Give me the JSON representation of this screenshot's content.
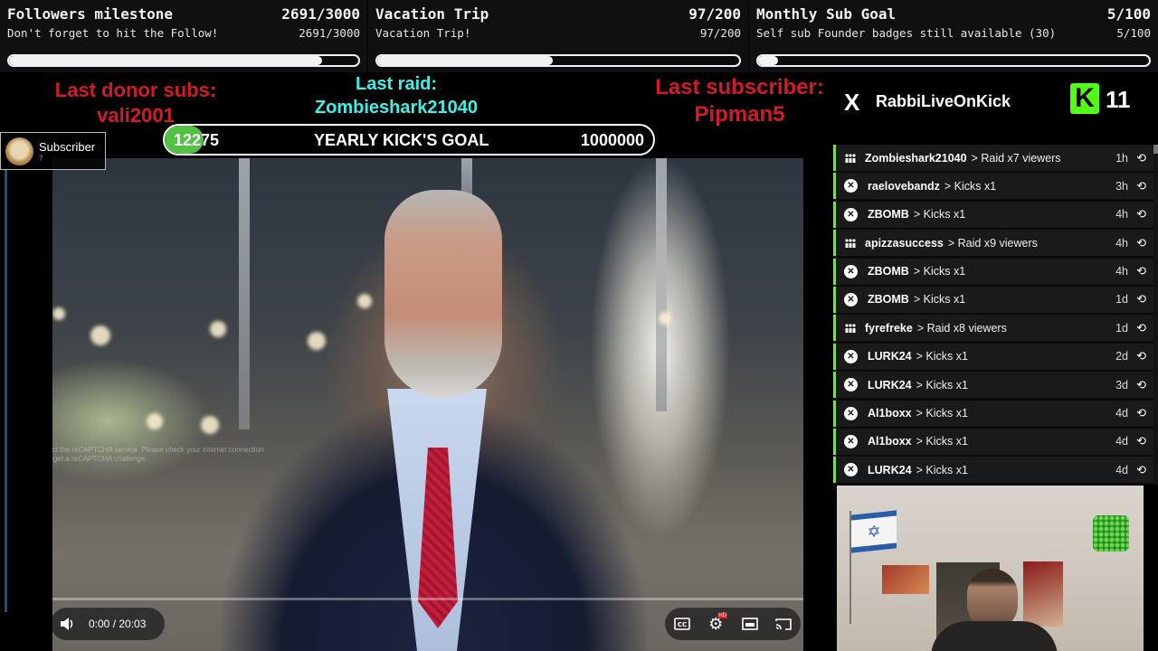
{
  "goals": [
    {
      "title": "Followers milestone",
      "count": "2691/3000",
      "subtitle": "Don't forget to hit the Follow!",
      "sub_count": "2691/3000",
      "progress": 0.897
    },
    {
      "title": "Vacation Trip",
      "count": "97/200",
      "subtitle": "Vacation Trip!",
      "sub_count": "97/200",
      "progress": 0.485
    },
    {
      "title": "Monthly Sub Goal",
      "count": "5/100",
      "subtitle": "Self sub Founder badges still available (30)",
      "sub_count": "5/100",
      "progress": 0.05
    }
  ],
  "last_donor": {
    "label": "Last donor subs:",
    "name": "vali2001"
  },
  "last_raid": {
    "label": "Last raid:",
    "name": "Zombieshark21040"
  },
  "last_subscriber": {
    "label": "Last subscriber:",
    "name": "Pipman5"
  },
  "yearly_goal": {
    "current": "12275",
    "label": "YEARLY KICK'S GOAL",
    "target": "1000000",
    "progress": 0.012275
  },
  "subscriber_badge": {
    "label": "Subscriber",
    "count": "7"
  },
  "channel": {
    "x_icon": "X",
    "name": "RabbiLiveOnKick",
    "kick_icon": "K",
    "kick_count": "11"
  },
  "events": [
    {
      "user": "Zombieshark21040",
      "action": "> Raid x7 viewers",
      "time": "1h",
      "type": "raid"
    },
    {
      "user": "raelovebandz",
      "action": "> Kicks x1",
      "time": "3h",
      "type": "kick"
    },
    {
      "user": "ZBOMB",
      "action": "> Kicks x1",
      "time": "4h",
      "type": "kick"
    },
    {
      "user": "apizzasuccess",
      "action": "> Raid x9 viewers",
      "time": "4h",
      "type": "raid"
    },
    {
      "user": "ZBOMB",
      "action": "> Kicks x1",
      "time": "4h",
      "type": "kick"
    },
    {
      "user": "ZBOMB",
      "action": "> Kicks x1",
      "time": "1d",
      "type": "kick"
    },
    {
      "user": "fyrefreke",
      "action": "> Raid x8 viewers",
      "time": "1d",
      "type": "raid"
    },
    {
      "user": "LURK24",
      "action": "> Kicks x1",
      "time": "2d",
      "type": "kick"
    },
    {
      "user": "LURK24",
      "action": "> Kicks x1",
      "time": "3d",
      "type": "kick"
    },
    {
      "user": "Al1boxx",
      "action": "> Kicks x1",
      "time": "4d",
      "type": "kick"
    },
    {
      "user": "Al1boxx",
      "action": "> Kicks x1",
      "time": "4d",
      "type": "kick"
    },
    {
      "user": "LURK24",
      "action": "> Kicks x1",
      "time": "4d",
      "type": "kick"
    }
  ],
  "video": {
    "time": "0:00 / 20:03",
    "captcha_notice": "Cannot contact the reCAPTCHA service. Please check your internet connection and reload to get a reCAPTCHA challenge.",
    "icons": {
      "pause": "pause-icon",
      "volume": "volume-icon",
      "cc": "cc-icon",
      "settings": "gear-icon",
      "miniplayer": "miniplayer-icon",
      "cast": "cast-icon",
      "fullscreen": "fullscreen-icon"
    },
    "hd_badge": "HD"
  },
  "colors": {
    "kick_green": "#53fc18",
    "donor_red": "#d01c24",
    "raid_cyan": "#3ff0e6"
  }
}
